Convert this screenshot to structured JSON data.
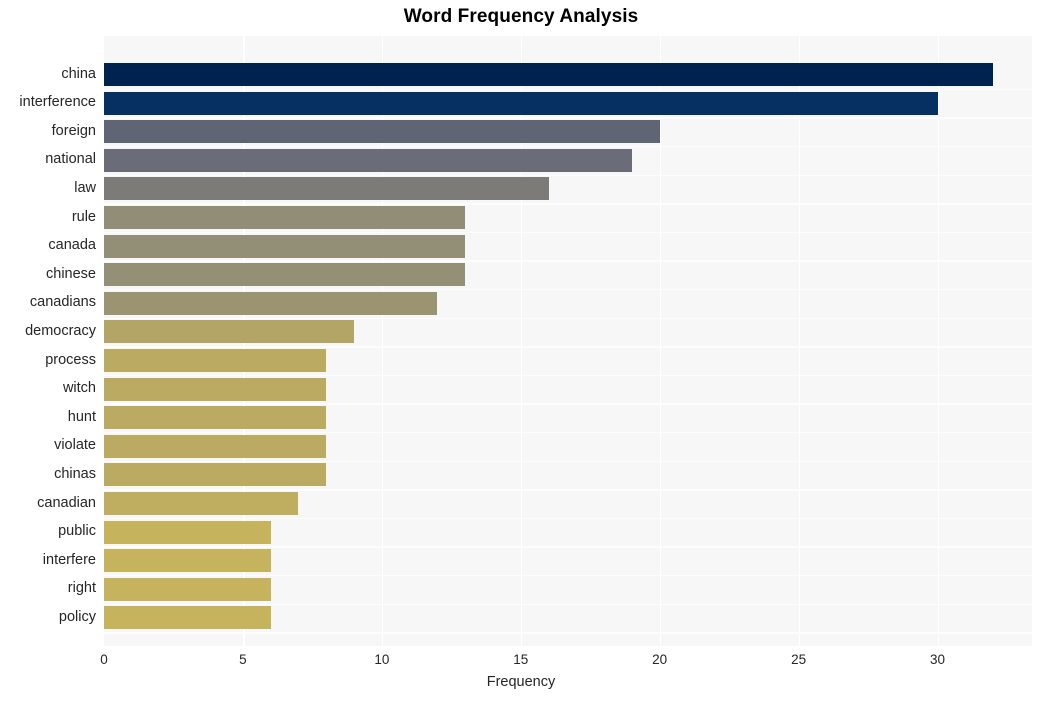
{
  "chart_data": {
    "type": "bar",
    "orientation": "horizontal",
    "title": "Word Frequency Analysis",
    "xlabel": "Frequency",
    "ylabel": "",
    "categories": [
      "china",
      "interference",
      "foreign",
      "national",
      "law",
      "rule",
      "canada",
      "chinese",
      "canadians",
      "democracy",
      "process",
      "witch",
      "hunt",
      "violate",
      "chinas",
      "canadian",
      "public",
      "interfere",
      "right",
      "policy"
    ],
    "values": [
      32,
      30,
      20,
      19,
      16,
      13,
      13,
      13,
      12,
      9,
      8,
      8,
      8,
      8,
      8,
      7,
      6,
      6,
      6,
      6
    ],
    "xticks": [
      0,
      5,
      10,
      15,
      20,
      25,
      30
    ],
    "xtick_labels": [
      "0",
      "5",
      "10",
      "15",
      "20",
      "25",
      "30"
    ],
    "xlim": [
      0,
      33.4
    ],
    "grid": true,
    "legend": false,
    "colormap": "cividis",
    "bar_colors": [
      "#00224e",
      "#053061",
      "#606576",
      "#6a6c78",
      "#7d7b78",
      "#918d77",
      "#938f76",
      "#949075",
      "#9a9472",
      "#b3a566",
      "#bbab62",
      "#bbab62",
      "#bbab62",
      "#bbab62",
      "#bbab62",
      "#bfae60",
      "#c5b35d",
      "#c5b35d",
      "#c5b35d",
      "#c5b35d"
    ],
    "plot_bgcolor": "#f7f7f7",
    "gridline_color": "#ffffff",
    "page_bgcolor": "#ffffff",
    "text_color": "#262626"
  }
}
